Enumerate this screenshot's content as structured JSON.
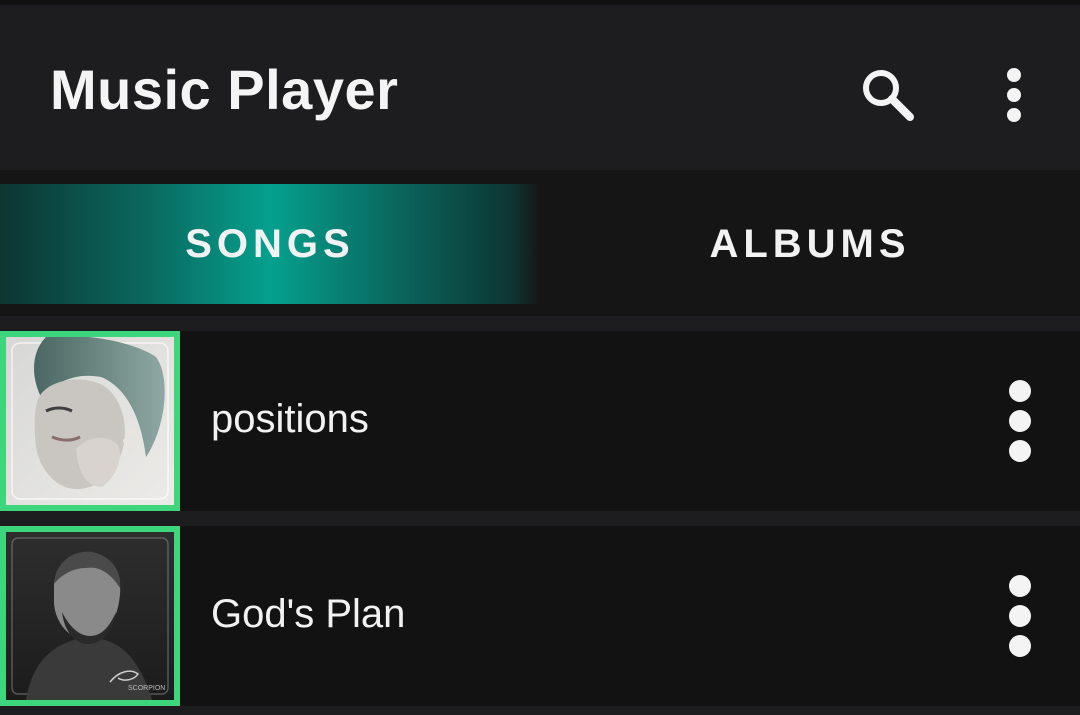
{
  "app_bar": {
    "title": "Music Player",
    "search_icon": "search-icon",
    "overflow_icon": "more-vertical-icon"
  },
  "tabs": [
    {
      "label": "SONGS",
      "selected": true
    },
    {
      "label": "ALBUMS",
      "selected": false
    }
  ],
  "songs": [
    {
      "title": "positions",
      "cover_icon": "album-cover-image",
      "menu_icon": "more-vertical-icon"
    },
    {
      "title": "God's Plan",
      "cover_icon": "album-cover-image",
      "menu_icon": "more-vertical-icon"
    }
  ],
  "colors": {
    "accent_teal": "#05a08e",
    "cover_border_green": "#3dd67d",
    "background": "#171718",
    "text": "#f2f2f2"
  }
}
